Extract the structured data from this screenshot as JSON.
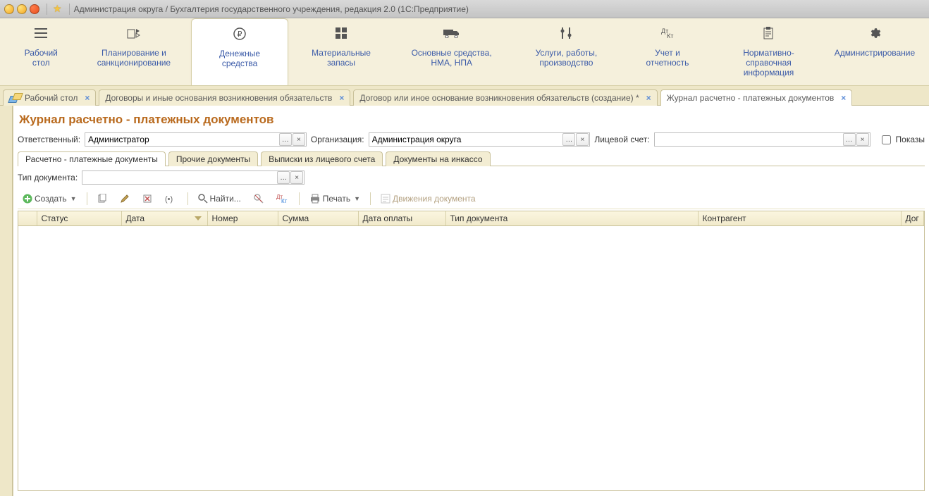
{
  "title": "Администрация округа / Бухгалтерия государственного учреждения, редакция 2.0  (1С:Предприятие)",
  "sections": [
    {
      "label": "Рабочий стол"
    },
    {
      "label": "Планирование и санкционирование"
    },
    {
      "label": "Денежные средства"
    },
    {
      "label": "Материальные запасы"
    },
    {
      "label": "Основные средства, НМА, НПА"
    },
    {
      "label": "Услуги, работы, производство"
    },
    {
      "label": "Учет и отчетность"
    },
    {
      "label": "Нормативно-справочная информация"
    },
    {
      "label": "Администрирование"
    }
  ],
  "wintabs": [
    {
      "label": "Рабочий стол"
    },
    {
      "label": "Договоры и иные основания возникновения обязательств"
    },
    {
      "label": "Договор или иное основание возникновения обязательств (создание) *"
    },
    {
      "label": "Журнал расчетно - платежных документов"
    }
  ],
  "page": {
    "heading": "Журнал расчетно - платежных документов",
    "filters": {
      "responsible_label": "Ответственный:",
      "responsible_value": "Администратор",
      "org_label": "Организация:",
      "org_value": "Администрация округа",
      "account_label": "Лицевой счет:",
      "account_value": "",
      "show_label": "Показы"
    },
    "subtabs": [
      "Расчетно - платежные документы",
      "Прочие документы",
      "Выписки из лицевого счета",
      "Документы на инкассо"
    ],
    "doctype_label": "Тип документа:",
    "doctype_value": "",
    "toolbar": {
      "create": "Создать",
      "find": "Найти...",
      "print": "Печать",
      "movements": "Движения документа"
    },
    "columns": [
      "",
      "Статус",
      "Дата",
      "Номер",
      "Сумма",
      "Дата оплаты",
      "Тип документа",
      "Контрагент",
      "Дог"
    ]
  }
}
